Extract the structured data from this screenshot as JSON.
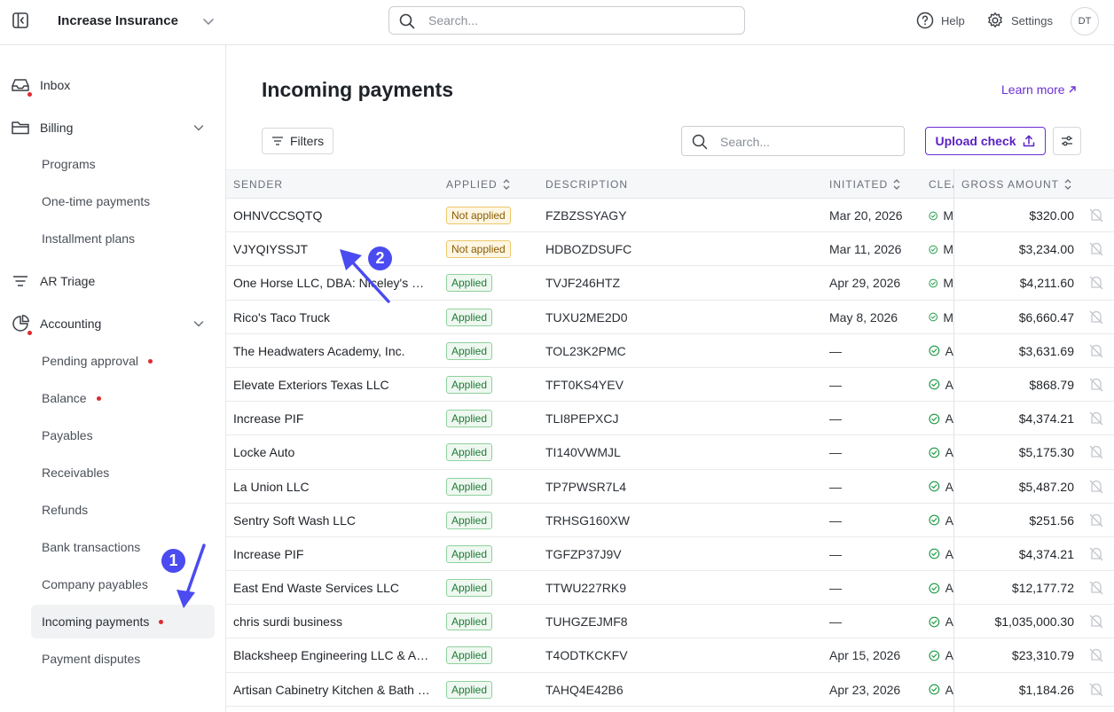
{
  "topbar": {
    "org_name": "Increase Insurance",
    "search_placeholder": "Search...",
    "help_label": "Help",
    "settings_label": "Settings",
    "avatar_initials": "DT"
  },
  "sidebar": {
    "inbox": "Inbox",
    "billing": "Billing",
    "billing_items": [
      "Programs",
      "One-time payments",
      "Installment plans"
    ],
    "ar_triage": "AR Triage",
    "accounting": "Accounting",
    "accounting_items": [
      {
        "label": "Pending approval",
        "dot": true
      },
      {
        "label": "Balance",
        "dot": true
      },
      {
        "label": "Payables",
        "dot": false
      },
      {
        "label": "Receivables",
        "dot": false
      },
      {
        "label": "Refunds",
        "dot": false
      },
      {
        "label": "Bank transactions",
        "dot": false
      },
      {
        "label": "Company payables",
        "dot": false
      },
      {
        "label": "Incoming payments",
        "dot": true,
        "active": true
      },
      {
        "label": "Payment disputes",
        "dot": false
      }
    ]
  },
  "main": {
    "title": "Incoming payments",
    "learn_more": "Learn more",
    "filters_label": "Filters",
    "search_placeholder": "Search...",
    "upload_label": "Upload check",
    "columns": {
      "sender": "SENDER",
      "applied": "APPLIED",
      "description": "DESCRIPTION",
      "initiated": "INITIATED",
      "cleared": "CLEA",
      "gross": "GROSS AMOUNT"
    },
    "rows": [
      {
        "sender": "OHNVCCSQTQ",
        "applied": "Not applied",
        "description": "FZBZSSYAGY",
        "initiated": "Mar 20, 2026",
        "cleared": "M",
        "gross": "$320.00"
      },
      {
        "sender": "VJYQIYSSJT",
        "applied": "Not applied",
        "description": "HDBOZDSUFC",
        "initiated": "Mar 11, 2026",
        "cleared": "M",
        "gross": "$3,234.00"
      },
      {
        "sender": "One Horse LLC, DBA: Niceley's Custom Exhausts",
        "applied": "Applied",
        "description": "TVJF246HTZ",
        "initiated": "Apr 29, 2026",
        "cleared": "M",
        "gross": "$4,211.60"
      },
      {
        "sender": "Rico's Taco Truck",
        "applied": "Applied",
        "description": "TUXU2ME2D0",
        "initiated": "May 8, 2026",
        "cleared": "M",
        "gross": "$6,660.47"
      },
      {
        "sender": "The Headwaters Academy, Inc.",
        "applied": "Applied",
        "description": "TOL23K2PMC",
        "initiated": "—",
        "cleared": "A",
        "gross": "$3,631.69"
      },
      {
        "sender": "Elevate Exteriors Texas LLC",
        "applied": "Applied",
        "description": "TFT0KS4YEV",
        "initiated": "—",
        "cleared": "A",
        "gross": "$868.79"
      },
      {
        "sender": "Increase PIF",
        "applied": "Applied",
        "description": "TLI8PEPXCJ",
        "initiated": "—",
        "cleared": "A",
        "gross": "$4,374.21"
      },
      {
        "sender": "Locke Auto",
        "applied": "Applied",
        "description": "TI140VWMJL",
        "initiated": "—",
        "cleared": "A",
        "gross": "$5,175.30"
      },
      {
        "sender": "La Union LLC",
        "applied": "Applied",
        "description": "TP7PWSR7L4",
        "initiated": "—",
        "cleared": "A",
        "gross": "$5,487.20"
      },
      {
        "sender": "Sentry Soft Wash LLC",
        "applied": "Applied",
        "description": "TRHSG160XW",
        "initiated": "—",
        "cleared": "A",
        "gross": "$251.56"
      },
      {
        "sender": "Increase PIF",
        "applied": "Applied",
        "description": "TGFZP37J9V",
        "initiated": "—",
        "cleared": "A",
        "gross": "$4,374.21"
      },
      {
        "sender": "East End Waste Services LLC",
        "applied": "Applied",
        "description": "TTWU227RK9",
        "initiated": "—",
        "cleared": "A",
        "gross": "$12,177.72"
      },
      {
        "sender": "chris surdi business",
        "applied": "Applied",
        "description": "TUHGZEJMF8",
        "initiated": "—",
        "cleared": "A",
        "gross": "$1,035,000.30"
      },
      {
        "sender": "Blacksheep Engineering LLC & Associates",
        "applied": "Applied",
        "description": "T4ODTKCKFV",
        "initiated": "Apr 15, 2026",
        "cleared": "A",
        "gross": "$23,310.79"
      },
      {
        "sender": "Artisan Cabinetry Kitchen & Bath LLC",
        "applied": "Applied",
        "description": "TAHQ4E42B6",
        "initiated": "Apr 23, 2026",
        "cleared": "A",
        "gross": "$1,184.26"
      }
    ]
  },
  "annotations": {
    "one": "1",
    "two": "2"
  },
  "colors": {
    "accent": "#6b2fd6",
    "annotation": "#4a4bf0",
    "dot": "#e0292e"
  }
}
